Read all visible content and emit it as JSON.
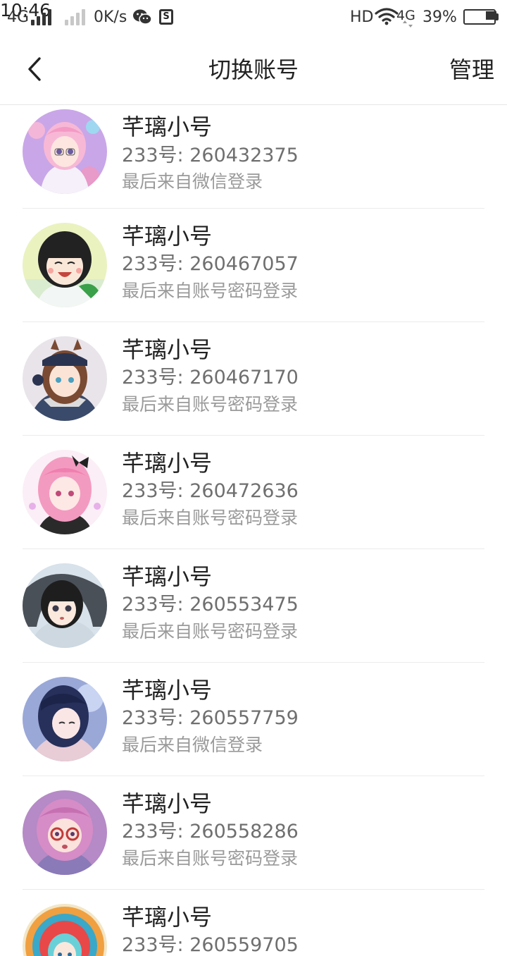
{
  "status_bar": {
    "network1": "4G",
    "speed": "0K/s",
    "time": "10:46",
    "hd": "HD",
    "network2": "4G",
    "battery": "39%",
    "battery_level": 0.39
  },
  "header": {
    "title": "切换账号",
    "manage_label": "管理"
  },
  "accounts": [
    {
      "name": "芊璃小号",
      "id": "233号: 260432375",
      "login": "最后来自微信登录",
      "avatar": "anime-girl-pink-hair-avatar"
    },
    {
      "name": "芊璃小号",
      "id": "233号: 260467057",
      "login": "最后来自账号密码登录",
      "avatar": "anime-girl-black-hair-smiling-avatar"
    },
    {
      "name": "芊璃小号",
      "id": "233号: 260467170",
      "login": "最后来自账号密码登录",
      "avatar": "anime-girl-brown-hair-cap-avatar"
    },
    {
      "name": "芊璃小号",
      "id": "233号: 260472636",
      "login": "最后来自账号密码登录",
      "avatar": "anime-girl-pink-hair-bow-avatar"
    },
    {
      "name": "芊璃小号",
      "id": "233号: 260553475",
      "login": "最后来自账号密码登录",
      "avatar": "anime-girl-black-hair-hood-avatar"
    },
    {
      "name": "芊璃小号",
      "id": "233号: 260557759",
      "login": "最后来自微信登录",
      "avatar": "anime-girl-dark-blue-hair-avatar"
    },
    {
      "name": "芊璃小号",
      "id": "233号: 260558286",
      "login": "最后来自账号密码登录",
      "avatar": "anime-girl-purple-hair-glasses-avatar"
    },
    {
      "name": "芊璃小号",
      "id": "233号: 260559705",
      "login": "",
      "avatar": "anime-girl-colorful-avatar"
    }
  ]
}
